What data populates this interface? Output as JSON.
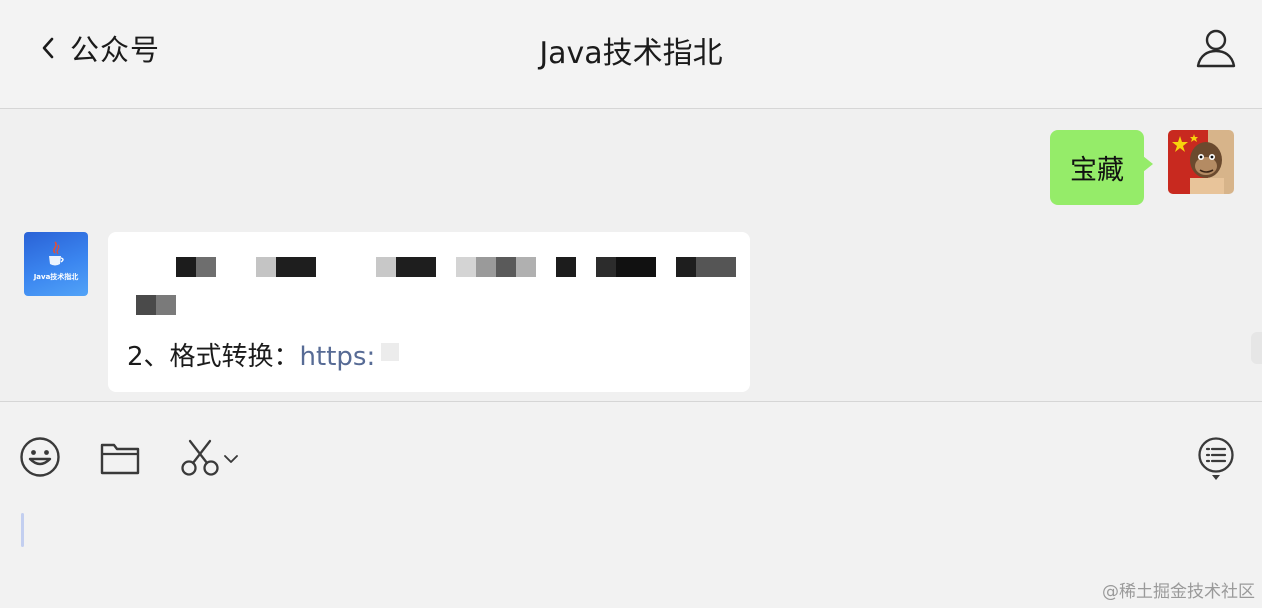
{
  "header": {
    "back_label": "公众号",
    "title": "Java技术指北"
  },
  "messages": {
    "outgoing": {
      "text": "宝藏"
    },
    "incoming": {
      "avatar_text": "Java技术指北",
      "format_label": "2、格式转换：",
      "link_text": "https:"
    }
  },
  "icons": {
    "back": "chevron-left-icon",
    "profile": "person-icon",
    "emoji": "emoji-icon",
    "folder": "folder-icon",
    "screenshot": "scissors-icon",
    "history": "chat-history-icon"
  },
  "colors": {
    "outgoing_bubble": "#95ec69",
    "link": "#576b95",
    "avatar_bg": "#3b86f0"
  },
  "watermark": "@稀土掘金技术社区"
}
